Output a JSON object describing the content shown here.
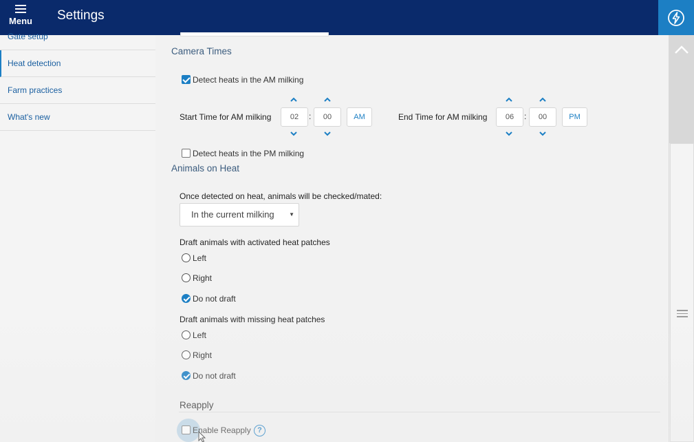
{
  "header": {
    "menu_label": "Menu",
    "title": "Settings"
  },
  "sidebar": {
    "items": [
      {
        "label": "Gate setup"
      },
      {
        "label": "Heat detection"
      },
      {
        "label": "Farm practices"
      },
      {
        "label": "What's new"
      }
    ]
  },
  "camera_times": {
    "heading": "Camera Times",
    "am_checkbox": {
      "label": "Detect heats in the AM milking",
      "checked": true
    },
    "start": {
      "label": "Start Time for AM milking",
      "hour": "02",
      "minute": "00",
      "period": "AM"
    },
    "end": {
      "label": "End Time for AM milking",
      "hour": "06",
      "minute": "00",
      "period": "PM"
    },
    "separator": ":",
    "pm_checkbox": {
      "label": "Detect heats in the PM milking",
      "checked": false
    }
  },
  "animals_on_heat": {
    "heading": "Animals on Heat",
    "checked_label": "Once detected on heat, animals will be checked/mated:",
    "select_value": "In the current milking",
    "activated": {
      "label": "Draft animals with activated heat patches",
      "options": [
        "Left",
        "Right",
        "Do not draft"
      ],
      "selected": "Do not draft"
    },
    "missing": {
      "label": "Draft animals with missing heat patches",
      "options": [
        "Left",
        "Right",
        "Do not draft"
      ],
      "selected": "Do not draft"
    }
  },
  "reapply": {
    "heading": "Reapply",
    "enable_label": "Enable Reapply",
    "enabled": false,
    "help_glyph": "?"
  },
  "colors": {
    "header_bg": "#0a2a6b",
    "accent": "#1c7fc4",
    "link": "#1a5fa0"
  },
  "icons": [
    "hamburger-icon",
    "lightning-bolt-icon",
    "chevron-up-icon",
    "chevron-down-icon",
    "help-icon",
    "dropdown-caret-icon",
    "grip-icon"
  ]
}
